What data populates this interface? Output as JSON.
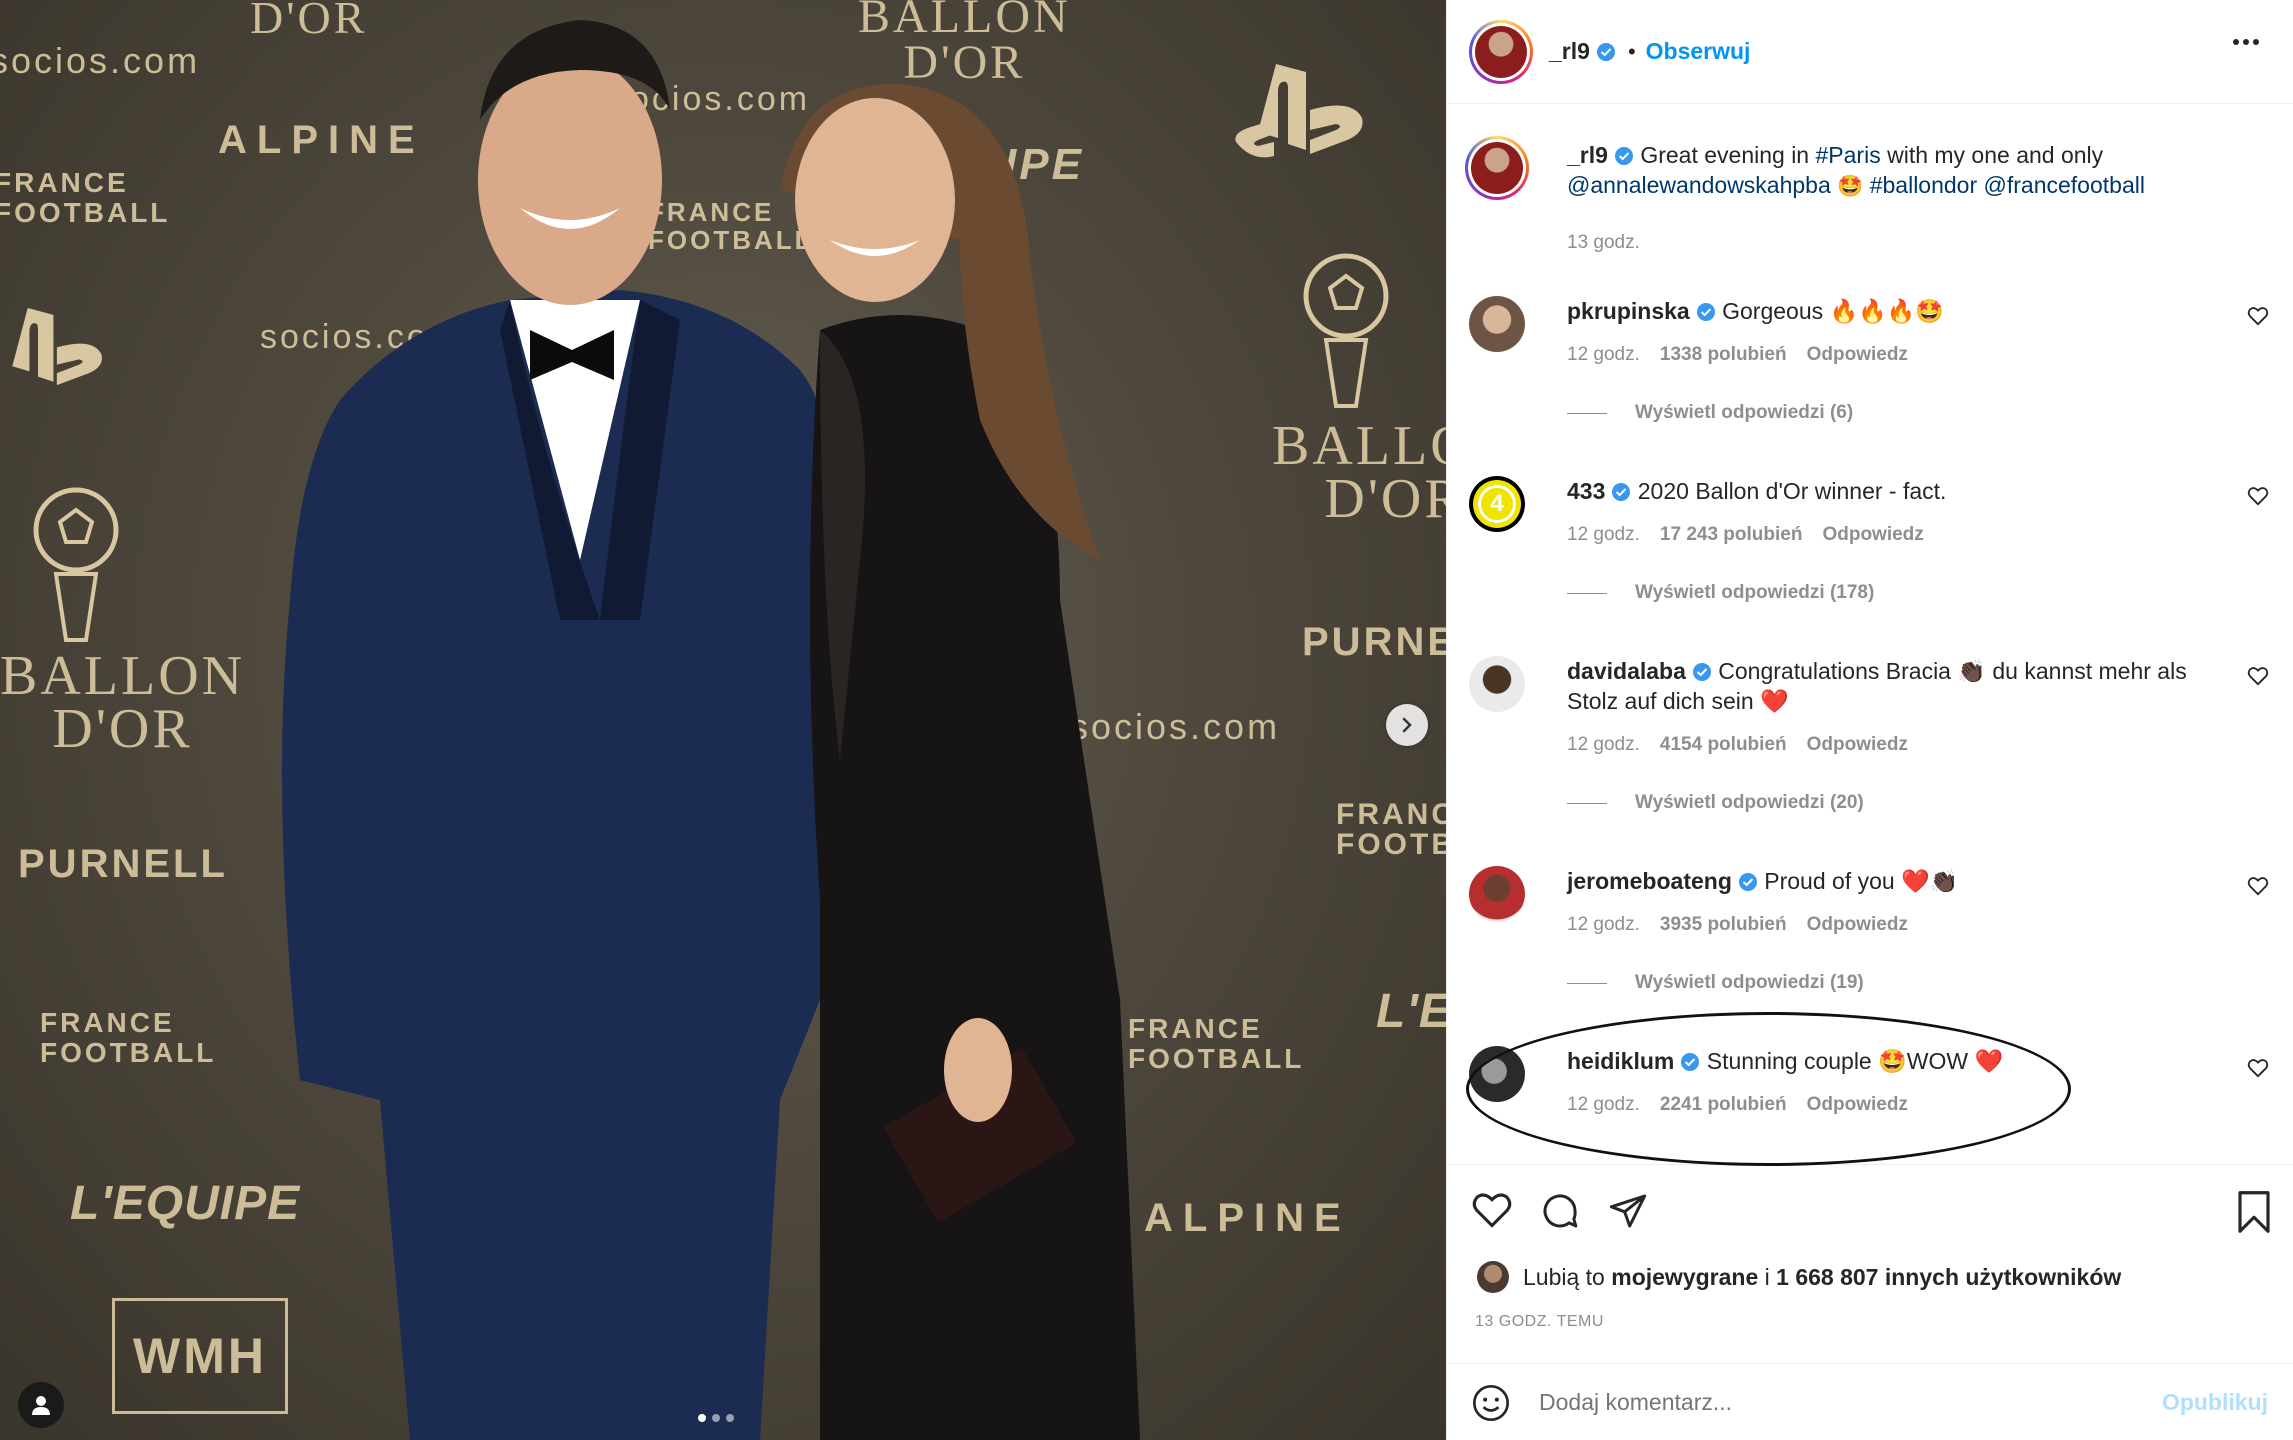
{
  "post": {
    "username": "_rl9",
    "follow_label": "Obserwuj",
    "separator": "•",
    "caption_text": "Great evening in",
    "caption_hashtag_paris": "#Paris",
    "caption_text2": "with my one and only",
    "caption_mention": "@annalewandowskahpba",
    "caption_emoji": "🤩",
    "caption_hashtag_ballondor": "#ballondor",
    "caption_mention2": "@francefootball",
    "caption_time": "13 godz."
  },
  "photo": {
    "backdrop_logos": {
      "socios": "socios.com",
      "alpine": "ALPINE",
      "france_football": "FRANCE FOOTBALL",
      "ballon": "BALLON",
      "dor": "D'OR",
      "purnell": "PURNELL",
      "lequipe": "L'EQUIPE",
      "wmh": "WMH",
      "ipe": "IPE"
    }
  },
  "comments": [
    {
      "username": "pkrupinska",
      "text": "Gorgeous 🔥🔥🔥🤩",
      "time": "12 godz.",
      "likes": "1338 polubień",
      "reply": "Odpowiedz",
      "view_replies": "Wyświetl odpowiedzi (6)"
    },
    {
      "username": "433",
      "text": "2020 Ballon d'Or winner - fact.",
      "time": "12 godz.",
      "likes": "17 243 polubień",
      "reply": "Odpowiedz",
      "view_replies": "Wyświetl odpowiedzi (178)"
    },
    {
      "username": "davidalaba",
      "text": "Congratulations Bracia 👏🏿 du kannst mehr als Stolz auf dich sein ❤️",
      "time": "12 godz.",
      "likes": "4154 polubień",
      "reply": "Odpowiedz",
      "view_replies": "Wyświetl odpowiedzi (20)"
    },
    {
      "username": "jeromeboateng",
      "text": "Proud of you ❤️👏🏿",
      "time": "12 godz.",
      "likes": "3935 polubień",
      "reply": "Odpowiedz",
      "view_replies": "Wyświetl odpowiedzi (19)"
    },
    {
      "username": "heidiklum",
      "text": "Stunning couple 🤩WOW ❤️",
      "time": "12 godz.",
      "likes": "2241 polubień",
      "reply": "Odpowiedz"
    }
  ],
  "footer": {
    "likes_prefix": "Lubią to",
    "likes_user": "mojewygrane",
    "likes_join": "i",
    "likes_count": "1 668 807 innych użytkowników",
    "time_ago": "13 GODZ. TEMU",
    "add_comment_placeholder": "Dodaj komentarz...",
    "publish_label": "Opublikuj"
  },
  "colors": {
    "accent": "#0095f6",
    "verified": "#3897f0",
    "muted": "#8e8e8e",
    "link": "#00376b"
  },
  "icons": [
    "verified-icon",
    "more-options-icon",
    "heart-icon",
    "comment-icon",
    "share-icon",
    "bookmark-icon",
    "emoji-icon",
    "chevron-right-icon",
    "user-tag-icon"
  ]
}
